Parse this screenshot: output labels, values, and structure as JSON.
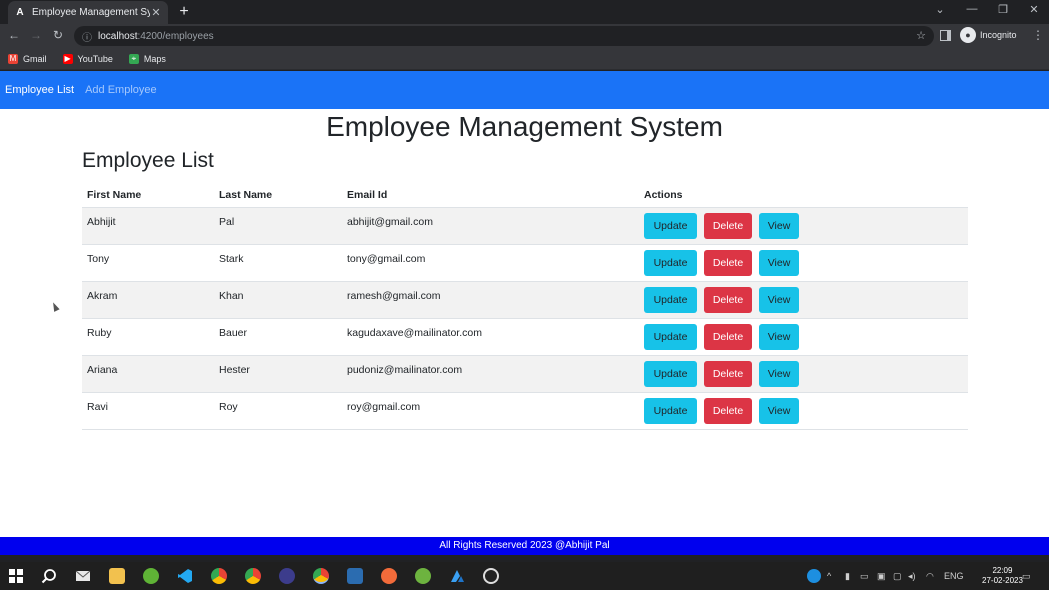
{
  "browser": {
    "tab_title": "Employee Management System",
    "tab_favicon": "A",
    "url_host": "localhost",
    "url_path": ":4200/employees",
    "profile_label": "Incognito",
    "bookmarks": [
      {
        "label": "Gmail",
        "icon": "gmail-icon",
        "color": "#ea4335"
      },
      {
        "label": "YouTube",
        "icon": "youtube-icon",
        "color": "#ff0000"
      },
      {
        "label": "Maps",
        "icon": "maps-icon",
        "color": "#34a853"
      }
    ]
  },
  "nav": {
    "items": [
      {
        "label": "Employee List",
        "active": true
      },
      {
        "label": "Add Employee",
        "active": false
      }
    ]
  },
  "page": {
    "title": "Employee Management System",
    "section_title": "Employee List"
  },
  "table": {
    "headers": [
      "First Name",
      "Last Name",
      "Email Id",
      "Actions"
    ],
    "rows": [
      {
        "first": "Abhijit",
        "last": "Pal",
        "email": "abhijit@gmail.com"
      },
      {
        "first": "Tony",
        "last": "Stark",
        "email": "tony@gmail.com"
      },
      {
        "first": "Akram",
        "last": "Khan",
        "email": "ramesh@gmail.com"
      },
      {
        "first": "Ruby",
        "last": "Bauer",
        "email": "kagudaxave@mailinator.com"
      },
      {
        "first": "Ariana",
        "last": "Hester",
        "email": "pudoniz@mailinator.com"
      },
      {
        "first": "Ravi",
        "last": "Roy",
        "email": "roy@gmail.com"
      }
    ],
    "buttons": {
      "update": "Update",
      "delete": "Delete",
      "view": "View"
    }
  },
  "footer": {
    "text": "All Rights Reserved 2023 @Abhijit Pal"
  },
  "taskbar": {
    "language": "ENG",
    "time": "22:09",
    "date": "27-02-2023"
  },
  "colors": {
    "navbar": "#1a73f7",
    "footer": "#0000ee",
    "btn_info": "#17c2e8",
    "btn_danger": "#dc3545"
  }
}
